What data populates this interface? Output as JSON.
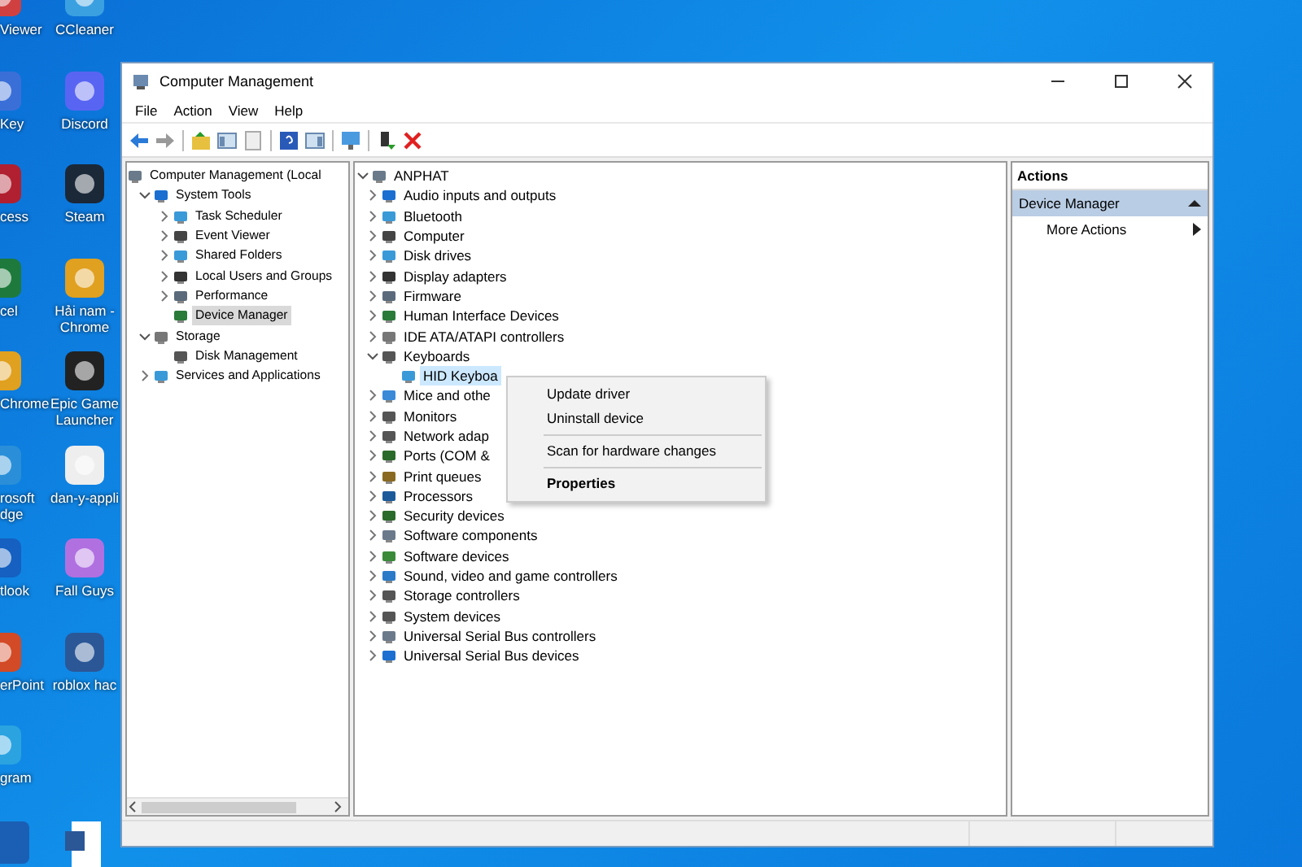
{
  "desktop_left_column": [
    {
      "label": "Viewer"
    },
    {
      "label": "Key"
    },
    {
      "label": "cess"
    },
    {
      "label": "cel"
    },
    {
      "label": "Chrome"
    },
    {
      "label": "rosoft dge"
    },
    {
      "label": "tlook"
    },
    {
      "label": "erPoint"
    },
    {
      "label": "gram"
    }
  ],
  "desktop_right_column": [
    {
      "label": "CCleaner"
    },
    {
      "label": "Discord"
    },
    {
      "label": "Steam"
    },
    {
      "label": "Hải nam - Chrome"
    },
    {
      "label": "Epic Game Launcher"
    },
    {
      "label": "dan-y-appli"
    },
    {
      "label": "Fall Guys"
    },
    {
      "label": "roblox hac"
    }
  ],
  "window": {
    "title": "Computer Management",
    "menu": [
      "File",
      "Action",
      "View",
      "Help"
    ]
  },
  "left_tree": [
    {
      "label": "Computer Management (Local",
      "selected": false,
      "children": [
        {
          "label": "System Tools",
          "expanded": true,
          "selected": false,
          "children": [
            {
              "label": "Task Scheduler",
              "expanded": false,
              "selected": false
            },
            {
              "label": "Event Viewer",
              "expanded": false,
              "selected": false
            },
            {
              "label": "Shared Folders",
              "expanded": false,
              "selected": false
            },
            {
              "label": "Local Users and Groups",
              "expanded": false,
              "selected": false
            },
            {
              "label": "Performance",
              "expanded": false,
              "selected": false
            },
            {
              "label": "Device Manager",
              "selected": true
            }
          ]
        },
        {
          "label": "Storage",
          "expanded": true,
          "selected": false,
          "children": [
            {
              "label": "Disk Management",
              "selected": false
            }
          ]
        },
        {
          "label": "Services and Applications",
          "expanded": false,
          "selected": false
        }
      ]
    }
  ],
  "device_tree": [
    {
      "label": "ANPHAT",
      "expanded": true,
      "selected": false,
      "children": [
        {
          "label": "Audio inputs and outputs",
          "expanded": false,
          "selected": false
        },
        {
          "label": "Bluetooth",
          "expanded": false,
          "selected": false
        },
        {
          "label": "Computer",
          "expanded": false,
          "selected": false
        },
        {
          "label": "Disk drives",
          "expanded": false,
          "selected": false
        },
        {
          "label": "Display adapters",
          "expanded": false,
          "selected": false
        },
        {
          "label": "Firmware",
          "expanded": false,
          "selected": false
        },
        {
          "label": "Human Interface Devices",
          "expanded": false,
          "selected": false
        },
        {
          "label": "IDE ATA/ATAPI controllers",
          "expanded": false,
          "selected": false
        },
        {
          "label": "Keyboards",
          "expanded": true,
          "selected": false,
          "children": [
            {
              "label": "HID Keyboa",
              "selected": true
            }
          ]
        },
        {
          "label": "Mice and othe",
          "expanded": false,
          "selected": false
        },
        {
          "label": "Monitors",
          "expanded": false,
          "selected": false
        },
        {
          "label": "Network adap",
          "expanded": false,
          "selected": false
        },
        {
          "label": "Ports (COM &",
          "expanded": false,
          "selected": false
        },
        {
          "label": "Print queues",
          "expanded": false,
          "selected": false
        },
        {
          "label": "Processors",
          "expanded": false,
          "selected": false
        },
        {
          "label": "Security devices",
          "expanded": false,
          "selected": false
        },
        {
          "label": "Software components",
          "expanded": false,
          "selected": false
        },
        {
          "label": "Software devices",
          "expanded": false,
          "selected": false
        },
        {
          "label": "Sound, video and game controllers",
          "expanded": false,
          "selected": false
        },
        {
          "label": "Storage controllers",
          "expanded": false,
          "selected": false
        },
        {
          "label": "System devices",
          "expanded": false,
          "selected": false
        },
        {
          "label": "Universal Serial Bus controllers",
          "expanded": false,
          "selected": false
        },
        {
          "label": "Universal Serial Bus devices",
          "expanded": false,
          "selected": false
        }
      ]
    }
  ],
  "context_menu": [
    {
      "label": "Update driver",
      "default": false,
      "separator_before": false
    },
    {
      "label": "Uninstall device",
      "default": false,
      "separator_before": false
    },
    {
      "label": "Scan for hardware changes",
      "default": false,
      "separator_before": true
    },
    {
      "label": "Properties",
      "default": true,
      "separator_before": true
    }
  ],
  "actions": {
    "title": "Actions",
    "section": {
      "label": "Device Manager",
      "expanded": true
    },
    "items": [
      {
        "label": "More Actions"
      }
    ]
  }
}
